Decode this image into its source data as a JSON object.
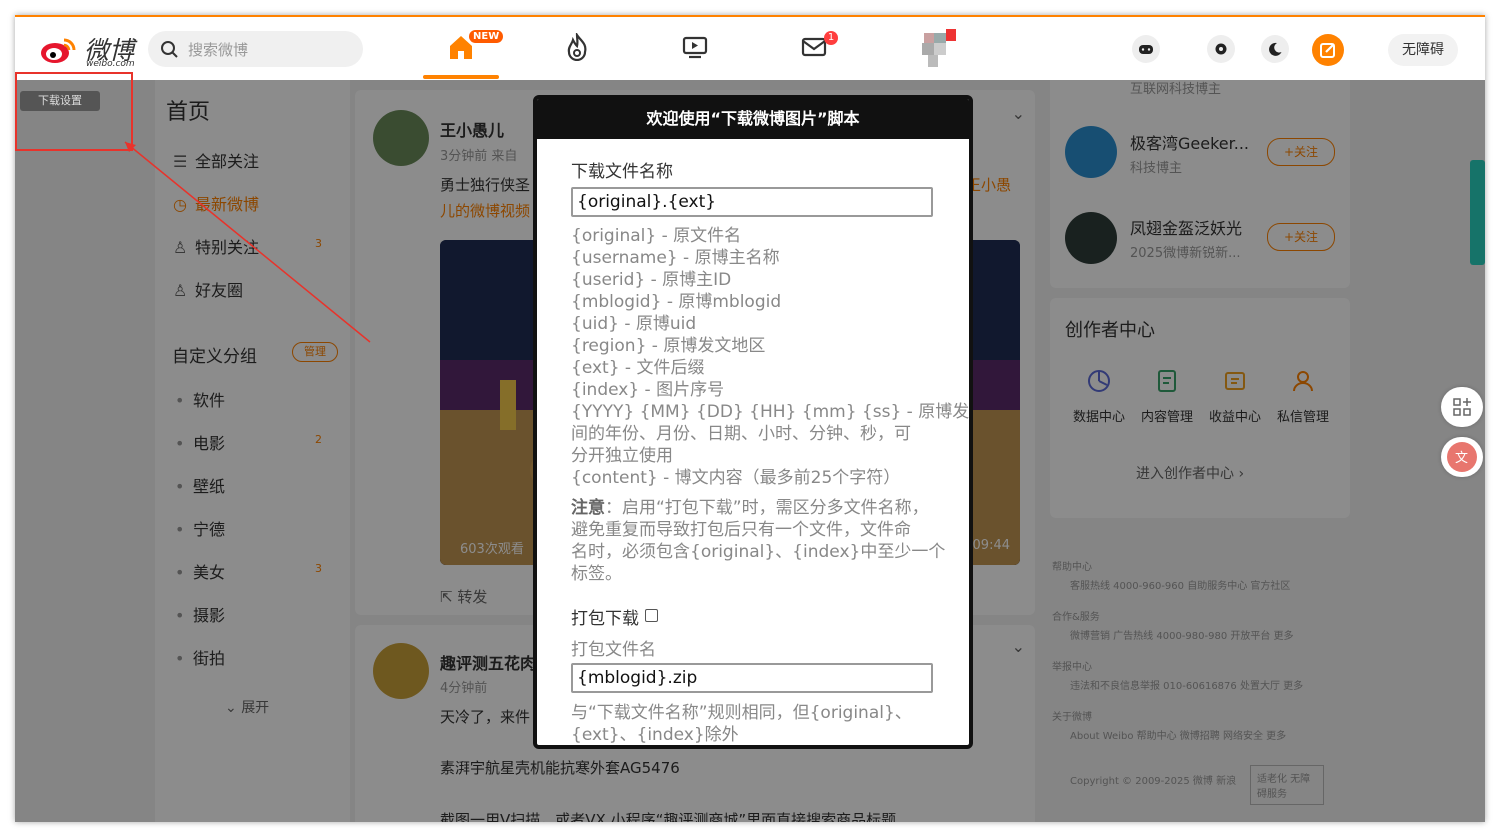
{
  "topnav": {
    "brand": "微博",
    "domain": "weibo.com",
    "search_placeholder": "搜索微博",
    "new_badge": "NEW",
    "message_count": "1",
    "accessibility": "无障碍",
    "accent_color": "#ff8200"
  },
  "script_button": {
    "label": "下载设置"
  },
  "sidebar": {
    "title": "首页",
    "items": [
      {
        "label": "全部关注",
        "icon": "list-icon"
      },
      {
        "label": "最新微博",
        "icon": "clock-icon"
      },
      {
        "label": "特别关注",
        "icon": "user-star-icon",
        "count": "3"
      },
      {
        "label": "好友圈",
        "icon": "friends-icon"
      }
    ],
    "group_title": "自定义分组",
    "manage": "管理",
    "groups": [
      {
        "label": "软件"
      },
      {
        "label": "电影",
        "count": "2"
      },
      {
        "label": "壁纸"
      },
      {
        "label": "宁德"
      },
      {
        "label": "美女",
        "count": "3"
      },
      {
        "label": "摄影"
      },
      {
        "label": "街拍"
      }
    ],
    "expand": "展开"
  },
  "feed": {
    "post1": {
      "name": "王小愚儿",
      "meta": "3分钟前  来自",
      "text": "勇士独行侠圣",
      "text_right": "王小愚",
      "link": "儿的微博视频",
      "views": "603次观看",
      "duration": "09:44",
      "repost": "转发"
    },
    "post2": {
      "name": "趣评测五花肉",
      "meta": "4分钟前",
      "line1": "天冷了，来件",
      "line2": "素湃宇航星壳机能抗寒外套AG5476",
      "line3": "截图一用V扫描，或者VX 小程序“趣评测商城”里面直接搜索商品标题"
    }
  },
  "right": {
    "top_desc": "互联网科技博主",
    "recommend": [
      {
        "name": "极客湾Geeker...",
        "desc": "科技博主",
        "follow": "+关注"
      },
      {
        "name": "凤翅金盔泛妖光",
        "desc": "2025微博新锐新...",
        "follow": "+关注"
      }
    ],
    "creator": {
      "title": "创作者中心",
      "items": [
        "数据中心",
        "内容管理",
        "收益中心",
        "私信管理"
      ],
      "enter": "进入创作者中心"
    },
    "footer": [
      {
        "title": "帮助中心",
        "line": "客服热线 4000-960-960  自助服务中心  官方社区"
      },
      {
        "title": "合作&服务",
        "line": "微博营销  广告热线 4000-980-980  开放平台  更多"
      },
      {
        "title": "举报中心",
        "line": "违法和不良信息举报 010-60616876  处置大厅  更多"
      },
      {
        "title": "关于微博",
        "line": "About Weibo  帮助中心  微博招聘  网络安全  更多"
      }
    ],
    "copyright": "Copyright © 2009-2025 微博 新浪",
    "elder": "适老化 无障碍服务"
  },
  "modal": {
    "title": "欢迎使用“下载微博图片”脚本",
    "filename_label": "下载文件名称",
    "filename_value": "{original}.{ext}",
    "help": [
      "{original} - 原文件名",
      "{username} - 原博主名称",
      "{userid} - 原博主ID",
      "{mblogid} - 原博mblogid",
      "{uid} - 原博uid",
      "{region} - 原博发文地区",
      "{ext} - 文件后缀",
      "{index} - 图片序号",
      "{YYYY} {MM} {DD} {HH} {mm} {ss} - 原博发布时",
      "间的年份、月份、日期、小时、分钟、秒，可",
      "分开独立使用",
      "{content} - 博文内容（最多前25个字符）"
    ],
    "note_label": "注意",
    "note_lines": [
      "：启用“打包下载”时，需区分多文件名称，",
      "避免重复而导致打包后只有一个文件，文件命",
      "名时，必须包含{original}、{index}中至少一个",
      "标签。"
    ],
    "zip_checkbox_label": "打包下载",
    "zip_name_label": "打包文件名",
    "zip_name_value": "{mblogid}.zip",
    "zip_help_lines": [
      "与“下载文件名称”规则相同，但{original}、",
      "{ext}、{index}除外"
    ]
  }
}
